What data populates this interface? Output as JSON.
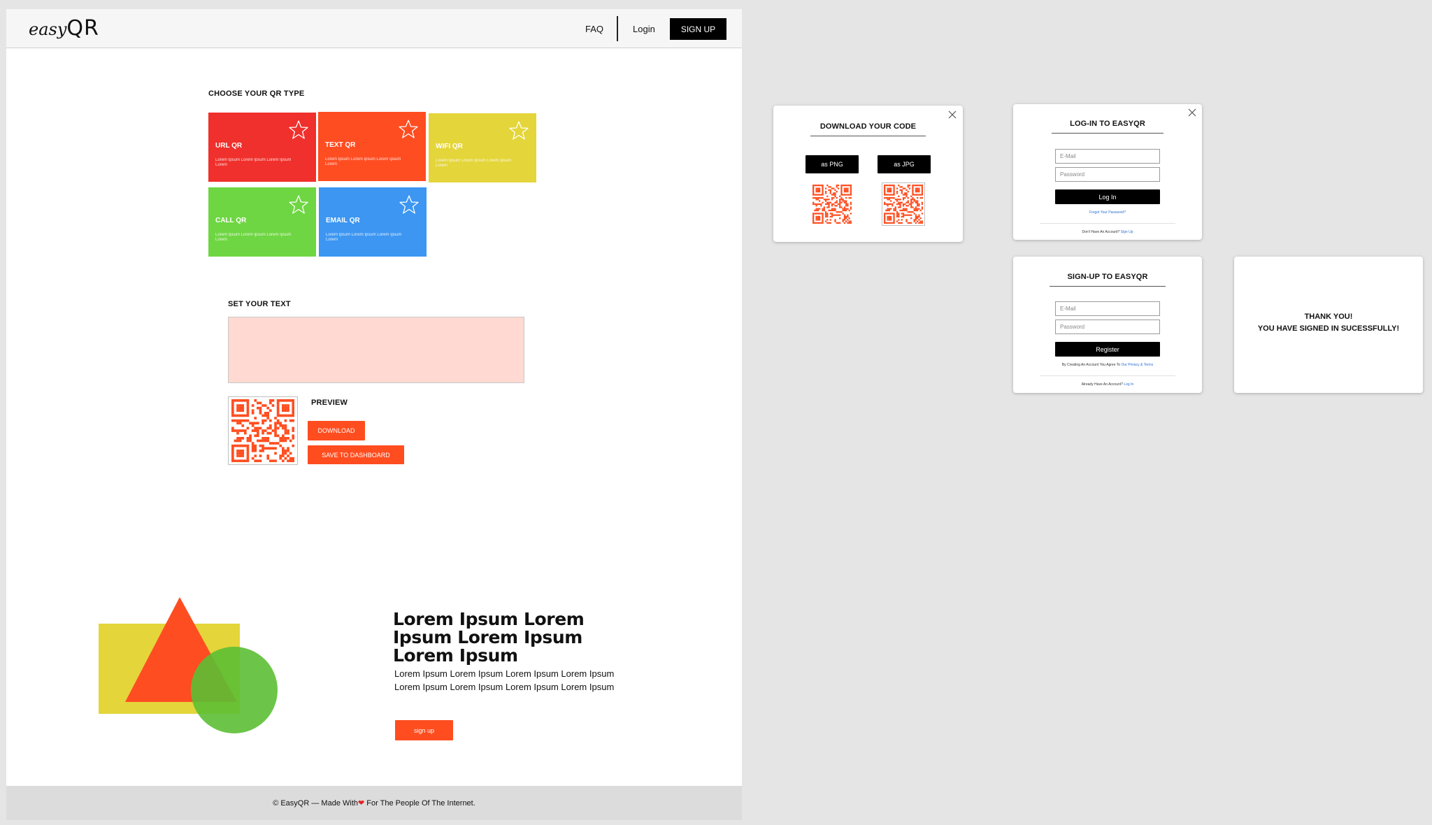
{
  "header": {
    "logo_prefix": "easy",
    "logo_suffix": "QR",
    "nav": {
      "faq": "FAQ",
      "login": "Login",
      "signup": "SIGN UP"
    }
  },
  "choose": {
    "title": "CHOOSE YOUR QR TYPE",
    "cards": [
      {
        "name": "URL QR",
        "desc": "Lorem Ipsum Lorem Ipsum Lorem Ipsum Lorem",
        "color": "#f0302c"
      },
      {
        "name": "TEXT QR",
        "desc": "Lorem Ipsum Lorem Ipsum Lorem Ipsum Lorem",
        "color": "#ff4d22"
      },
      {
        "name": "WIFI QR",
        "desc": "Lorem Ipsum Lorem Ipsum Lorem Ipsum Lorem",
        "color": "#e4d53a"
      },
      {
        "name": "CALL QR",
        "desc": "Lorem Ipsum Lorem Ipsum Lorem Ipsum Lorem",
        "color": "#6ed642"
      },
      {
        "name": "EMAIL QR",
        "desc": "Lorem Ipsum Lorem Ipsum Lorem Ipsum Lorem",
        "color": "#3c96f2"
      }
    ]
  },
  "set_text": {
    "title": "SET YOUR TEXT",
    "value": ""
  },
  "preview": {
    "title": "PREVIEW",
    "download": "DOWNLOAD",
    "save": "SAVE TO DASHBOARD",
    "qr_color": "#ff4d1f"
  },
  "hero": {
    "title": "Lorem Ipsum Lorem Ipsum Lorem Ipsum Lorem Ipsum",
    "body": "Lorem Ipsum Lorem Ipsum Lorem Ipsum Lorem Ipsum Lorem Ipsum Lorem Ipsum Lorem Ipsum Lorem Ipsum",
    "cta": "sign up",
    "shape_colors": {
      "rectangle": "#e4d53a",
      "triangle": "#ff4d22",
      "circle": "#5cbf34"
    }
  },
  "footer": {
    "before": "© EasyQR — Made With ",
    "heart": "❤",
    "after": " For The People Of The Internet."
  },
  "download_modal": {
    "title": "DOWNLOAD YOUR CODE",
    "png": "as PNG",
    "jpg": "as JPG"
  },
  "login_modal": {
    "title": "LOG-IN TO EASYQR",
    "email_placeholder": "E-Mail",
    "password_placeholder": "Password",
    "button": "Log In",
    "forgot": "Forgot Your Password?",
    "no_account": "Don't Have An Account?",
    "signup_link": "Sign Up"
  },
  "signup_modal": {
    "title": "SIGN-UP TO EASYQR",
    "email_placeholder": "E-Mail",
    "password_placeholder": "Password",
    "button": "Register",
    "agree_text": "By Creating An Account You Agree To",
    "agree_link": "Our Privacy & Terms",
    "have_account": "Already Have An Account?",
    "login_link": "Log In"
  },
  "thanks_modal": {
    "line1": "THANK YOU!",
    "line2": "YOU HAVE SIGNED IN SUCESSFULLY!"
  }
}
